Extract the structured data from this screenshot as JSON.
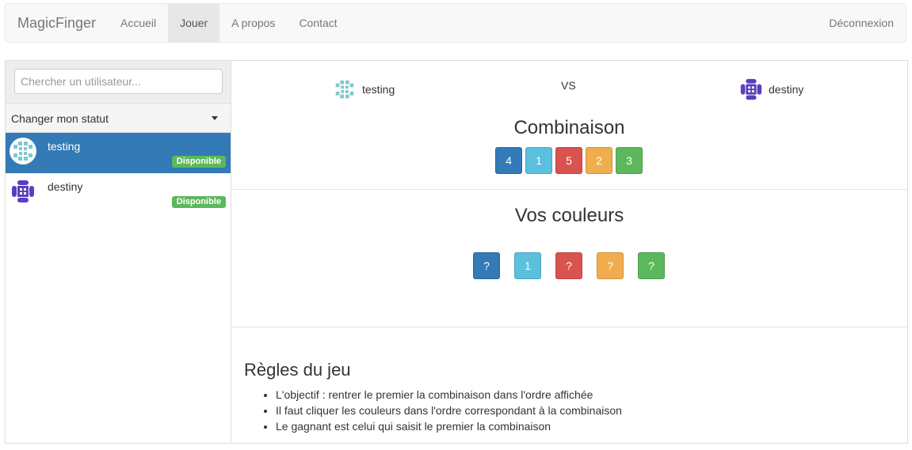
{
  "navbar": {
    "brand": "MagicFinger",
    "items": [
      {
        "label": "Accueil",
        "active": false
      },
      {
        "label": "Jouer",
        "active": true
      },
      {
        "label": "A propos",
        "active": false
      },
      {
        "label": "Contact",
        "active": false
      }
    ],
    "logout": "Déconnexion"
  },
  "sidebar": {
    "search_placeholder": "Chercher un utilisateur...",
    "status_label": "Changer mon statut",
    "users": [
      {
        "name": "testing",
        "status": "Disponible",
        "active": true
      },
      {
        "name": "destiny",
        "status": "Disponible",
        "active": false
      }
    ]
  },
  "game": {
    "player1": "testing",
    "vs": "VS",
    "player2": "destiny",
    "combination_title": "Combinaison",
    "combination": [
      {
        "value": "4",
        "color": "#337ab7"
      },
      {
        "value": "1",
        "color": "#5bc0de"
      },
      {
        "value": "5",
        "color": "#d9534f"
      },
      {
        "value": "2",
        "color": "#f0ad4e"
      },
      {
        "value": "3",
        "color": "#5cb85c"
      }
    ],
    "colors_title": "Vos couleurs",
    "colors": [
      {
        "value": "?",
        "color": "#337ab7"
      },
      {
        "value": "1",
        "color": "#5bc0de"
      },
      {
        "value": "?",
        "color": "#d9534f"
      },
      {
        "value": "?",
        "color": "#f0ad4e"
      },
      {
        "value": "?",
        "color": "#5cb85c"
      }
    ]
  },
  "rules": {
    "title": "Règles du jeu",
    "items": [
      "L'objectif : rentrer le premier la combinaison dans l'ordre affichée",
      "Il faut cliquer les couleurs dans l'ordre correspondant à la combinaison",
      "Le gagnant est celui qui saisit le premier la combinaison"
    ]
  },
  "colors": {
    "primary": "#337ab7",
    "info": "#5bc0de",
    "danger": "#d9534f",
    "warning": "#f0ad4e",
    "success": "#5cb85c"
  }
}
